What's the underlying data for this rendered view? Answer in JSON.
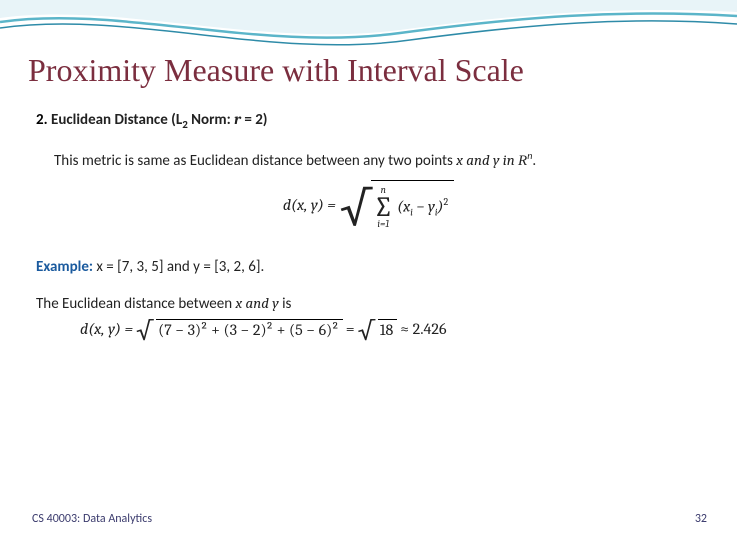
{
  "title": "Proximity Measure with Interval Scale",
  "heading": {
    "num": "2.",
    "name": "Euclidean Distance",
    "norm_open": "(L",
    "norm_sub": "2",
    "norm_mid": " Norm: ",
    "rvar": "r",
    "eq": " = 2)"
  },
  "line1": {
    "pre": "This metric is same as Euclidean distance between any two points ",
    "x": "x",
    "and": " and ",
    "y": "y",
    "in": " in ",
    "R": "R",
    "n": "n",
    "dot": "."
  },
  "formula1": {
    "lhs": "d(x, y) = ",
    "sigma_top": "n",
    "sigma_bot": "i=1",
    "term_open": "(x",
    "sub_i1": "i",
    "minus": " − y",
    "sub_i2": "i",
    "close": ")",
    "sq": "2"
  },
  "example": {
    "label": "Example:",
    "text": " x = [7, 3, 5] and y = [3, 2, 6]."
  },
  "line3": {
    "pre": "The Euclidean distance between ",
    "x": "x",
    "and": " and ",
    "y": "y",
    "is": "  is"
  },
  "formula2": {
    "lhs": "d(x, y) = ",
    "body": "(7 − 3)² + (3 − 2)² + (5 − 6)²",
    "eq": " = ",
    "val": "18",
    "approx": " ≈ 2.426"
  },
  "footer": {
    "left": "CS 40003: Data Analytics",
    "right": "32"
  }
}
